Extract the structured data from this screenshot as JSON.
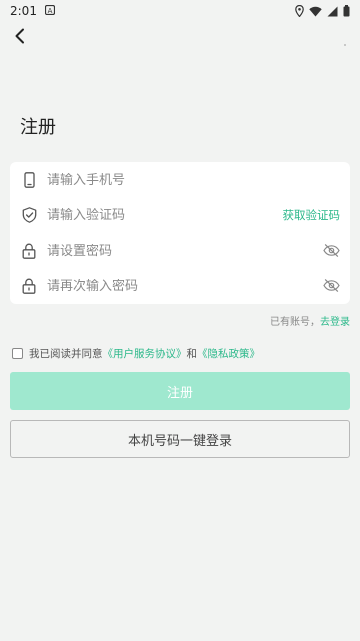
{
  "status_bar": {
    "time": "2:01",
    "icons": [
      "app-a-icon",
      "location-icon",
      "wifi-icon",
      "signal-icon",
      "battery-icon"
    ]
  },
  "header": {
    "back_icon": "chevron-left-icon",
    "title": "注册"
  },
  "form": {
    "phone": {
      "placeholder": "请输入手机号",
      "value": "",
      "icon": "phone-icon"
    },
    "code": {
      "placeholder": "请输入验证码",
      "value": "",
      "icon": "shield-check-icon",
      "action_label": "获取验证码"
    },
    "password": {
      "placeholder": "请设置密码",
      "value": "",
      "icon": "lock-icon",
      "toggle_icon": "eye-off-icon"
    },
    "confirm_password": {
      "placeholder": "请再次输入密码",
      "value": "",
      "icon": "lock-icon",
      "toggle_icon": "eye-off-icon"
    }
  },
  "login_hint": {
    "text": "已有账号，",
    "link": "去登录"
  },
  "agreement": {
    "checked": false,
    "prefix": "我已阅读并同意",
    "user_agreement": "《用户服务协议》",
    "conjunction": "和",
    "privacy_policy": "《隐私政策》"
  },
  "buttons": {
    "register": "注册",
    "quick_login": "本机号码一键登录"
  },
  "colors": {
    "accent": "#2bb88a",
    "register_button_disabled": "#9fe8cf",
    "background": "#f2f3f2"
  }
}
